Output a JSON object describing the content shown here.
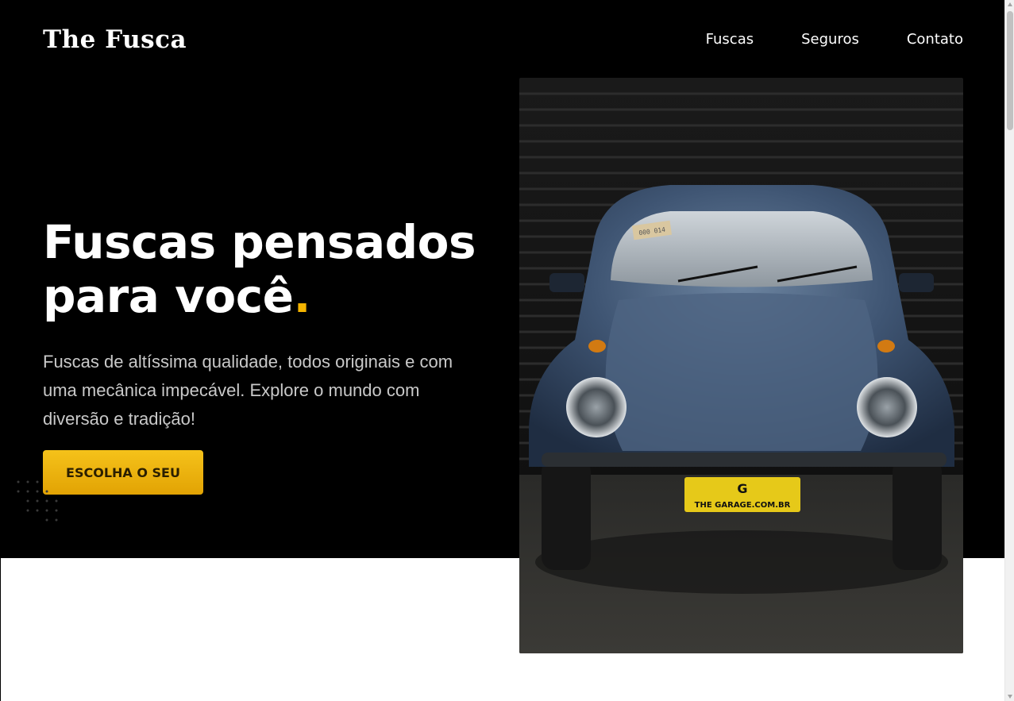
{
  "header": {
    "logo": "The Fusca",
    "nav": [
      {
        "label": "Fuscas"
      },
      {
        "label": "Seguros"
      },
      {
        "label": "Contato"
      }
    ]
  },
  "hero": {
    "headline_line1": "Fuscas pensados",
    "headline_line2": "para você",
    "headline_dot": ".",
    "description": "Fuscas de altíssima qualidade, todos originais e com uma mecânica impecável. Explore o mundo com diversão e tradição!",
    "cta_label": "ESCOLHA O SEU",
    "image": {
      "icon": "car-photo",
      "plate_text": "THE GARAGE.COM.BR",
      "plate_logo": "G",
      "sticker_text": "000 014"
    }
  },
  "colors": {
    "background": "#000000",
    "accent": "#f5b400",
    "text": "#ffffff",
    "muted_text": "#c9c9c9"
  }
}
